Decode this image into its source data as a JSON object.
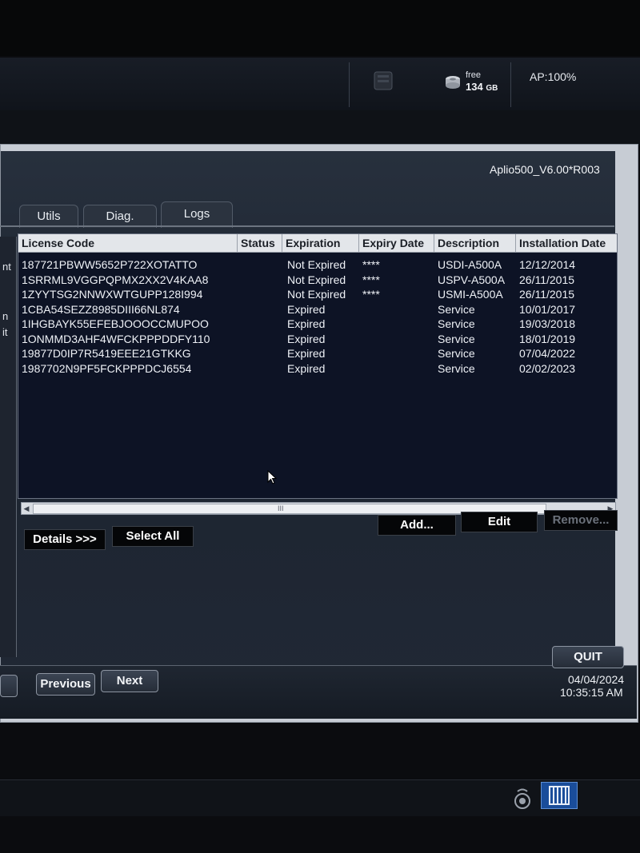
{
  "topbar": {
    "free_label": "free",
    "free_value": "134",
    "free_unit": "GB",
    "ap": "AP:100%"
  },
  "dialog": {
    "version": "Aplio500_V6.00*R003",
    "left_fragments": [
      "nt",
      "n",
      "it"
    ]
  },
  "tabs": [
    {
      "label": "Utils"
    },
    {
      "label": "Diag."
    },
    {
      "label": "Logs"
    }
  ],
  "table": {
    "columns": [
      "License Code",
      "Status",
      "Expiration",
      "Expiry Date",
      "Description",
      "Installation Date"
    ],
    "rows": [
      {
        "code": "187721PBWW5652P722XOTATTO",
        "status": "",
        "expiration": "Not Expired",
        "expiry": "****",
        "description": "USDI-A500A",
        "install": "12/12/2014"
      },
      {
        "code": "1SRRML9VGGPQPMX2XX2V4KAA8",
        "status": "",
        "expiration": "Not Expired",
        "expiry": "****",
        "description": "USPV-A500A",
        "install": "26/11/2015"
      },
      {
        "code": "1ZYYTSG2NNWXWTGUPP128I994",
        "status": "",
        "expiration": "Not Expired",
        "expiry": "****",
        "description": "USMI-A500A",
        "install": "26/11/2015"
      },
      {
        "code": "1CBA54SEZZ8985DIII66NL874",
        "status": "",
        "expiration": "Expired",
        "expiry": "",
        "description": "Service",
        "install": "10/01/2017"
      },
      {
        "code": "1IHGBAYK55EFEBJOOOCCMUPOO",
        "status": "",
        "expiration": "Expired",
        "expiry": "",
        "description": "Service",
        "install": "19/03/2018"
      },
      {
        "code": "1ONMMD3AHF4WFCKPPPDDFY110",
        "status": "",
        "expiration": "Expired",
        "expiry": "",
        "description": "Service",
        "install": "18/01/2019"
      },
      {
        "code": "19877D0IP7R5419EEE21GTKKG",
        "status": "",
        "expiration": "Expired",
        "expiry": "",
        "description": "Service",
        "install": "07/04/2022"
      },
      {
        "code": "1987702N9PF5FCKPPPDCJ6554",
        "status": "",
        "expiration": "Expired",
        "expiry": "",
        "description": "Service",
        "install": "02/02/2023"
      }
    ]
  },
  "scrollbar": {
    "grip": "III"
  },
  "buttons": {
    "details": "Details >>>",
    "select_all": "Select All",
    "add": "Add...",
    "edit": "Edit",
    "remove": "Remove...",
    "quit": "QUIT",
    "previous": "Previous",
    "next": "Next"
  },
  "footer": {
    "date": "04/04/2024",
    "time": "10:35:15 AM"
  }
}
